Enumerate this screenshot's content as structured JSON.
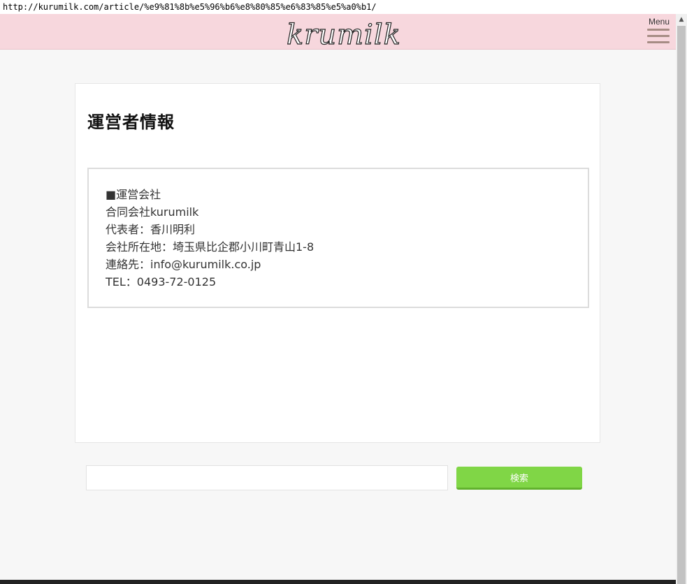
{
  "browser": {
    "url": "http://kurumilk.com/article/%e9%81%8b%e5%96%b6%e8%80%85%e6%83%85%e5%a0%b1/"
  },
  "header": {
    "logo_text": "krumilk",
    "menu_label": "Menu",
    "background": "#f7d7dd"
  },
  "article": {
    "title": "運営者情報",
    "info_lines": [
      "■運営会社",
      "合同会社kurumilk",
      "代表者：香川明利",
      "会社所在地：埼玉県比企郡小川町青山1-8",
      "連絡先：info@kurumilk.co.jp",
      "TEL：0493-72-0125"
    ]
  },
  "search": {
    "placeholder": "",
    "button_label": "検索",
    "button_color": "#80d646"
  },
  "scrollbar": {
    "up_arrow": "▲"
  }
}
